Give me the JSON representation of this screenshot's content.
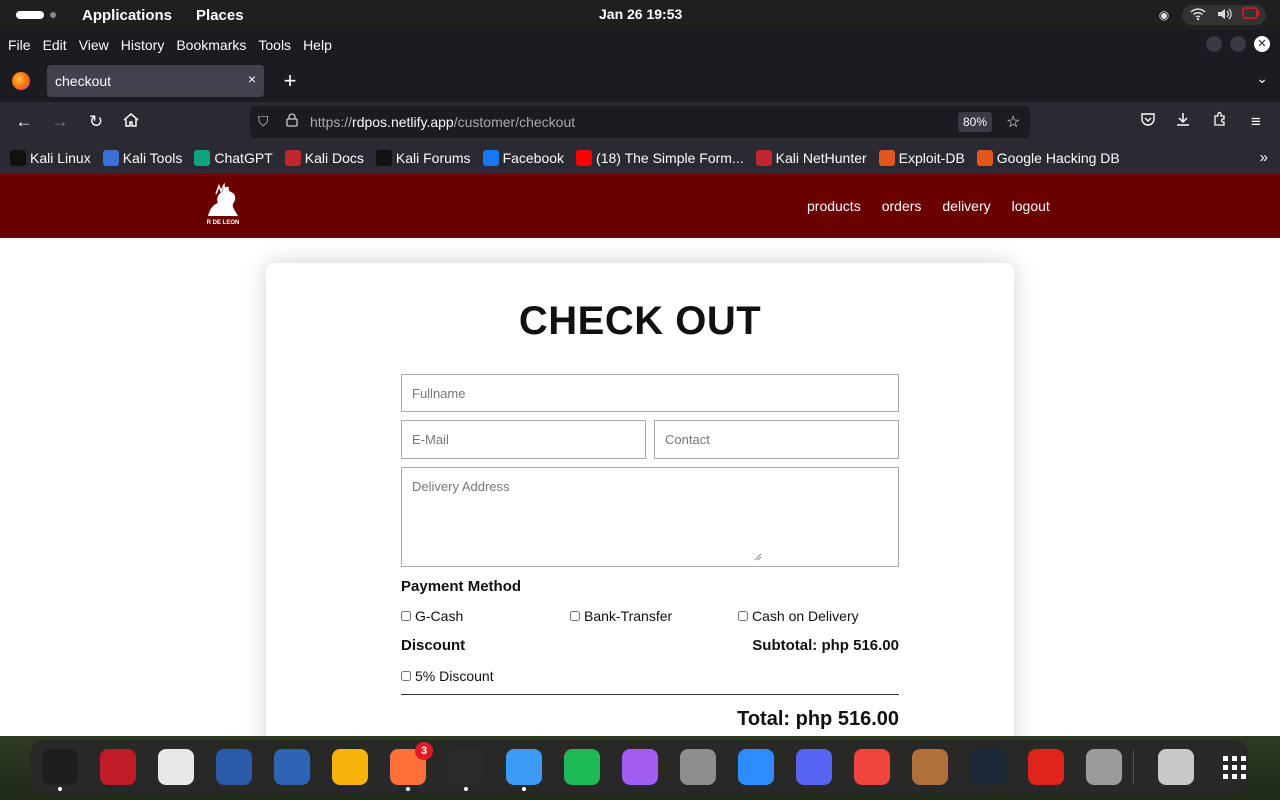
{
  "topbar": {
    "applications": "Applications",
    "places": "Places",
    "clock": "Jan 26  19:53"
  },
  "browser": {
    "menu": [
      "File",
      "Edit",
      "View",
      "History",
      "Bookmarks",
      "Tools",
      "Help"
    ],
    "tab_title": "checkout",
    "tab_close": "×",
    "new_tab": "+",
    "url_scheme": "https://",
    "url_domain": "rdpos.netlify.app",
    "url_path": "/customer/checkout",
    "zoom": "80%",
    "bookmarks": [
      {
        "label": "Kali Linux",
        "icon": "kali-dragon-icon",
        "color": "#111111"
      },
      {
        "label": "Kali Tools",
        "icon": "kali-tools-icon",
        "color": "#3b6fd6"
      },
      {
        "label": "ChatGPT",
        "icon": "chatgpt-icon",
        "color": "#10a37f"
      },
      {
        "label": "Kali Docs",
        "icon": "kali-docs-icon",
        "color": "#c0262d"
      },
      {
        "label": "Kali Forums",
        "icon": "kali-forums-icon",
        "color": "#111111"
      },
      {
        "label": "Facebook",
        "icon": "facebook-icon",
        "color": "#1877f2"
      },
      {
        "label": "(18) The Simple Form...",
        "icon": "youtube-icon",
        "color": "#ff0000"
      },
      {
        "label": "Kali NetHunter",
        "icon": "nethunter-icon",
        "color": "#c0262d"
      },
      {
        "label": "Exploit-DB",
        "icon": "exploit-db-icon",
        "color": "#e2571e"
      },
      {
        "label": "Google Hacking DB",
        "icon": "ghdb-icon",
        "color": "#e2571e"
      }
    ]
  },
  "site": {
    "brand": "R DE LEON",
    "nav": [
      "products",
      "orders",
      "delivery",
      "logout"
    ],
    "accent": "#6a0000"
  },
  "checkout": {
    "title": "CHECK OUT",
    "fullname_placeholder": "Fullname",
    "email_placeholder": "E-Mail",
    "contact_placeholder": "Contact",
    "address_placeholder": "Delivery Address",
    "payment_label": "Payment Method",
    "payment_options": [
      "G-Cash",
      "Bank-Transfer",
      "Cash on Delivery"
    ],
    "discount_label": "Discount",
    "discount_option": "5% Discount",
    "subtotal": "Subtotal: php 516.00",
    "total": "Total: php 516.00"
  },
  "dock": {
    "items": [
      {
        "name": "terminal-icon",
        "color": "#1e1e1e",
        "running": true
      },
      {
        "name": "root-terminal-icon",
        "color": "#c01c28",
        "running": false
      },
      {
        "name": "text-editor-icon",
        "color": "#e8e8e8",
        "running": false
      },
      {
        "name": "metasploit-icon",
        "color": "#2a5aa8",
        "running": false
      },
      {
        "name": "wireshark-icon",
        "color": "#2f63b4",
        "running": false
      },
      {
        "name": "orange-app-icon",
        "color": "#f6b30a",
        "running": false
      },
      {
        "name": "firefox-icon",
        "color": "#ff7139",
        "running": true,
        "badge": "3"
      },
      {
        "name": "vscode-icon",
        "color": "#2b2b2b",
        "running": true
      },
      {
        "name": "finder-icon",
        "color": "#3b9bf5",
        "running": true
      },
      {
        "name": "spotify-icon",
        "color": "#1db954",
        "running": false
      },
      {
        "name": "messenger-icon",
        "color": "#a25cf0",
        "running": false
      },
      {
        "name": "settings-icon",
        "color": "#8e8e8e",
        "running": false
      },
      {
        "name": "zoom-icon",
        "color": "#2d8cff",
        "running": false
      },
      {
        "name": "discord-icon",
        "color": "#5865f2",
        "running": false
      },
      {
        "name": "anydesk-icon",
        "color": "#ef443b",
        "running": false
      },
      {
        "name": "game-icon",
        "color": "#b0703a",
        "running": false
      },
      {
        "name": "steam-icon",
        "color": "#1b2838",
        "running": false
      },
      {
        "name": "acrobat-icon",
        "color": "#e0231b",
        "running": false
      },
      {
        "name": "volume-app-icon",
        "color": "#9a9a9a",
        "running": false
      },
      {
        "name": "trash-icon",
        "color": "#c8c8c8",
        "running": false
      },
      {
        "name": "app-grid-icon",
        "color": "#ffffff",
        "running": false
      }
    ]
  }
}
